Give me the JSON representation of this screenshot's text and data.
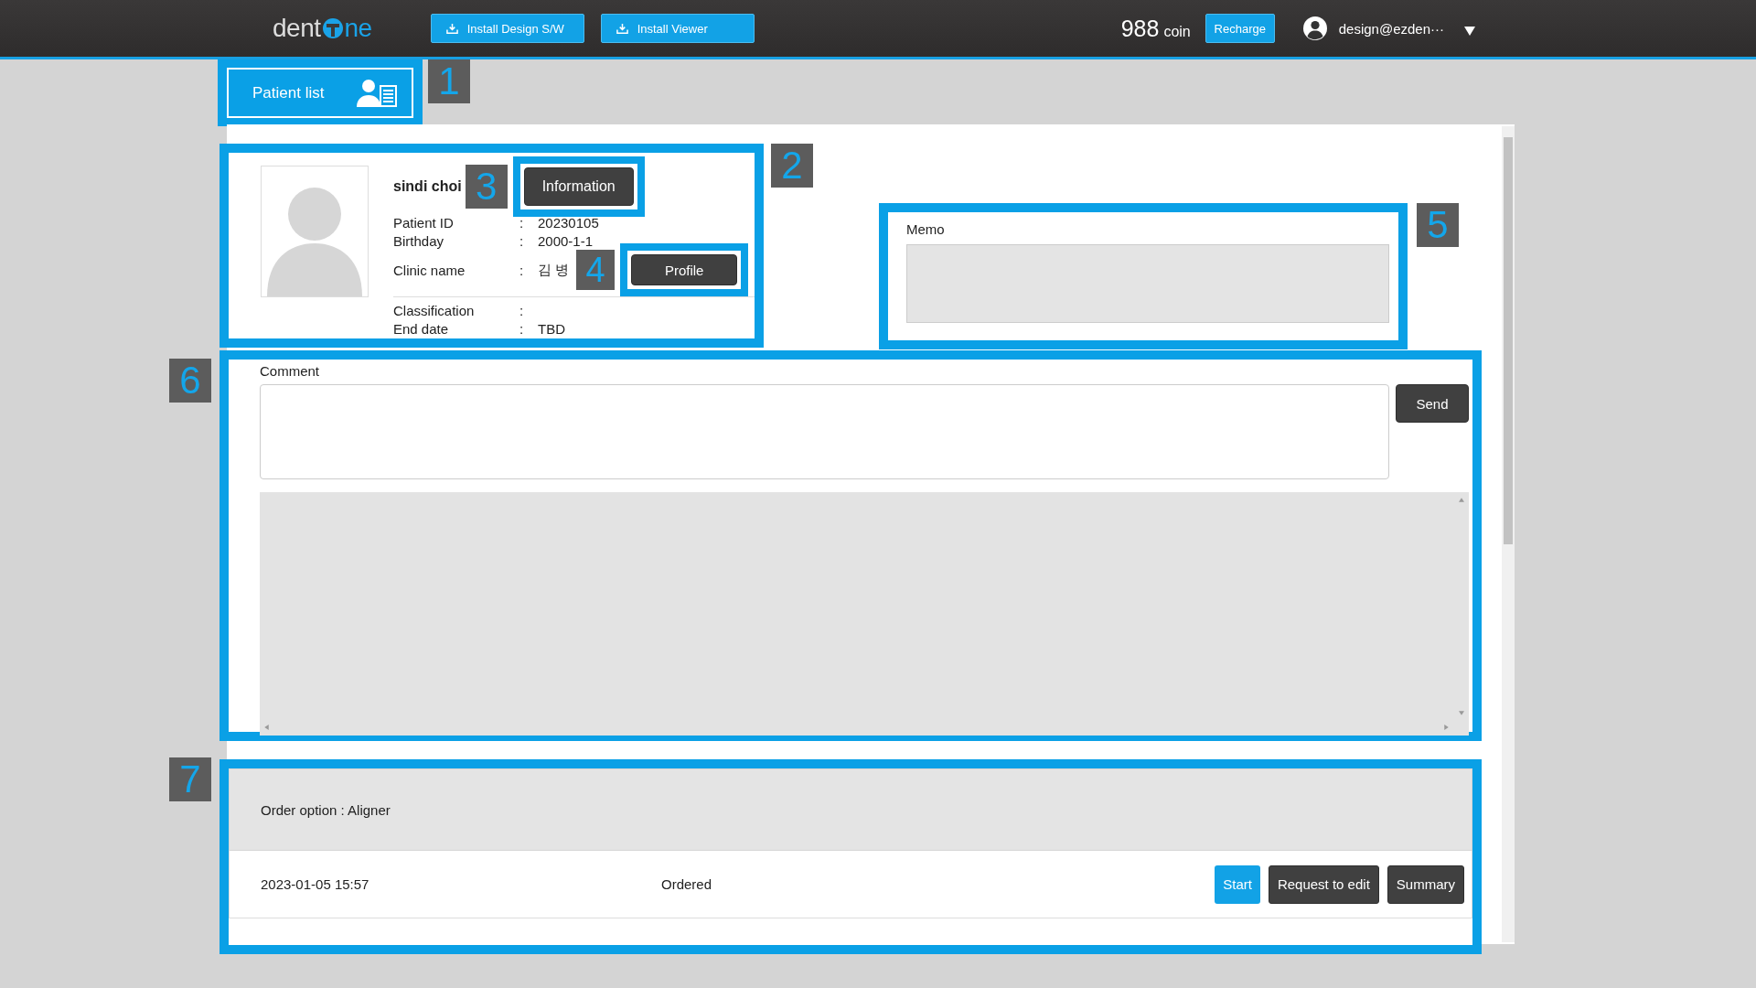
{
  "header": {
    "logo_start": "dent",
    "logo_end": "ne",
    "install_buttons": [
      {
        "label": "Install Design S/W"
      },
      {
        "label": "Install Viewer"
      }
    ],
    "coin_amount": "988",
    "coin_unit": "coin",
    "recharge": "Recharge",
    "user": "design@ezden···"
  },
  "patient_list": {
    "label": "Patient list",
    "callout": "1"
  },
  "patient": {
    "callout": "2",
    "name": "sindi choi",
    "information_button": {
      "label": "Information",
      "callout": "3"
    },
    "profile_button": {
      "label": "Profile",
      "callout": "4"
    },
    "fields": [
      {
        "label": "Patient ID",
        "separator": ":",
        "value": "20230105"
      },
      {
        "label": "Birthday",
        "separator": ":",
        "value": "2000-1-1"
      },
      {
        "label": "Clinic name",
        "separator": ":",
        "value": "김 병"
      }
    ],
    "extra_fields": [
      {
        "label": "Classification",
        "separator": ":"
      },
      {
        "label": "End date",
        "separator": ":",
        "value": "TBD"
      }
    ]
  },
  "memo": {
    "label": "Memo",
    "callout": "5"
  },
  "comment": {
    "label": "Comment",
    "send": "Send",
    "callout": "6"
  },
  "order": {
    "callout": "7",
    "option": "Order option : Aligner",
    "entries": [
      {
        "date": "2023-01-05 15:57",
        "status": "Ordered",
        "actions": [
          {
            "label": "Start",
            "kind": "primary"
          },
          {
            "label": "Request to edit",
            "kind": "dark"
          },
          {
            "label": "Summary",
            "kind": "dark"
          }
        ]
      }
    ]
  }
}
